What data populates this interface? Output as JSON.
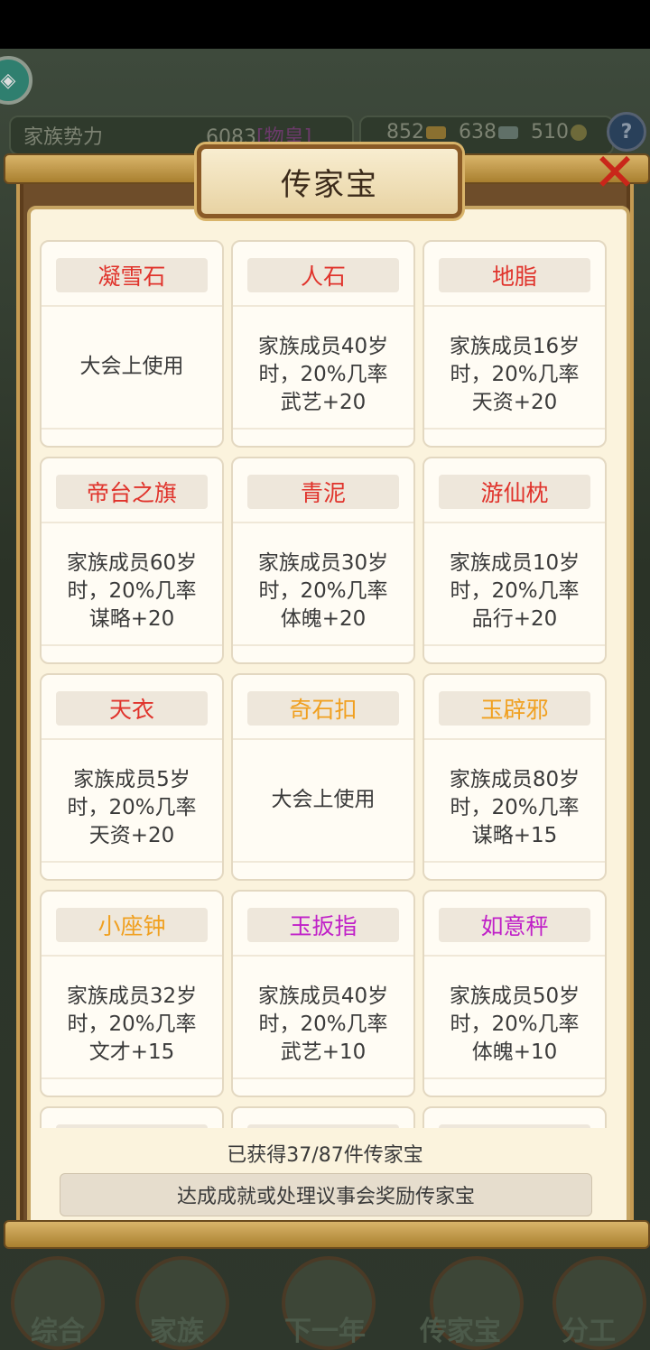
{
  "topbar": {
    "power_label": "家族势力",
    "power_value": "6083",
    "power_rank": "[物皇]",
    "resources": [
      {
        "value": "852",
        "icon": "gold-ingot-icon"
      },
      {
        "value": "638",
        "icon": "silver-icon"
      },
      {
        "value": "510",
        "icon": "coin-icon"
      }
    ],
    "help_icon": "?"
  },
  "modal": {
    "title": "传家宝",
    "close_glyph": "✕",
    "items": [
      {
        "name": "凝雪石",
        "color": "#e0332b",
        "desc": "大会上使用"
      },
      {
        "name": "人石",
        "color": "#e0332b",
        "desc": "家族成员40岁\n时，20%几率\n武艺+20"
      },
      {
        "name": "地脂",
        "color": "#e0332b",
        "desc": "家族成员16岁\n时，20%几率\n天资+20"
      },
      {
        "name": "帝台之旗",
        "color": "#e0332b",
        "desc": "家族成员60岁\n时，20%几率\n谋略+20"
      },
      {
        "name": "青泥",
        "color": "#e0332b",
        "desc": "家族成员30岁\n时，20%几率\n体魄+20"
      },
      {
        "name": "游仙枕",
        "color": "#e0332b",
        "desc": "家族成员10岁\n时，20%几率\n品行+20"
      },
      {
        "name": "天衣",
        "color": "#e0332b",
        "desc": "家族成员5岁\n时，20%几率\n天资+20"
      },
      {
        "name": "奇石扣",
        "color": "#f0a020",
        "desc": "大会上使用"
      },
      {
        "name": "玉辟邪",
        "color": "#f0a020",
        "desc": "家族成员80岁\n时，20%几率\n谋略+15"
      },
      {
        "name": "小座钟",
        "color": "#f0a020",
        "desc": "家族成员32岁\n时，20%几率\n文才+15"
      },
      {
        "name": "玉扳指",
        "color": "#c020c8",
        "desc": "家族成员40岁\n时，20%几率\n武艺+10"
      },
      {
        "name": "如意秤",
        "color": "#c020c8",
        "desc": "家族成员50岁\n时，20%几率\n体魄+10"
      },
      {
        "name": "",
        "color": "#e0332b",
        "desc": ""
      },
      {
        "name": "",
        "color": "#e0332b",
        "desc": ""
      },
      {
        "name": "",
        "color": "#e0332b",
        "desc": ""
      }
    ],
    "count_text": "已获得37/87件传家宝",
    "hint_button": "达成成就或处理议事会奖励传家宝"
  },
  "nav": [
    {
      "label": "综合"
    },
    {
      "label": "家族"
    },
    {
      "label": "下一年"
    },
    {
      "label": "传家宝"
    },
    {
      "label": "分工"
    }
  ]
}
